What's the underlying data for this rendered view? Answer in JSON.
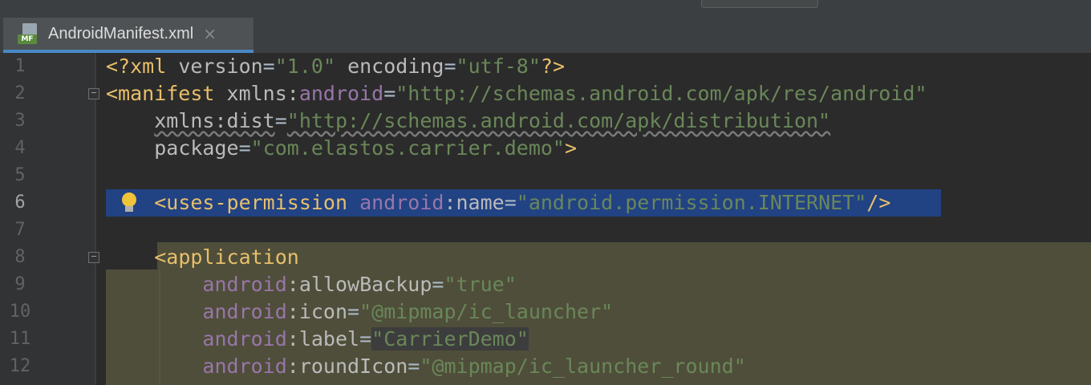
{
  "tab": {
    "file_label": "MF",
    "title": "AndroidManifest.xml",
    "close": "×"
  },
  "editor": {
    "line_numbers": [
      "1",
      "2",
      "3",
      "4",
      "5",
      "6",
      "7",
      "8",
      "9",
      "10",
      "11",
      "12"
    ],
    "lines": [
      [
        [
          "tag",
          "<?xml "
        ],
        [
          "attr",
          "version"
        ],
        [
          "str",
          "="
        ],
        [
          "val",
          "\"1.0\""
        ],
        [
          "str",
          " "
        ],
        [
          "attr",
          "encoding"
        ],
        [
          "str",
          "="
        ],
        [
          "val",
          "\"utf-8\""
        ],
        [
          "tag",
          "?>"
        ]
      ],
      [
        [
          "tag",
          "<manifest "
        ],
        [
          "attr",
          "xmlns:"
        ],
        [
          "ns",
          "android"
        ],
        [
          "str",
          "="
        ],
        [
          "val",
          "\"http://schemas.android.com/apk/res/android\""
        ]
      ],
      [
        [
          "str",
          "    "
        ],
        [
          "attr",
          "xmlns:dist"
        ],
        [
          "str",
          "="
        ],
        [
          "val",
          "\"http://schemas.android.com/apk/distribution\""
        ]
      ],
      [
        [
          "str",
          "    "
        ],
        [
          "attr",
          "package"
        ],
        [
          "str",
          "="
        ],
        [
          "val",
          "\"com.elastos.carrier.demo\""
        ],
        [
          "tag",
          ">"
        ]
      ],
      [],
      [
        [
          "str",
          "    "
        ],
        [
          "tag",
          "<uses-permission "
        ],
        [
          "ns",
          "android"
        ],
        [
          "attr",
          ":name"
        ],
        [
          "str",
          "="
        ],
        [
          "val",
          "\"android.permission.INTERNET\""
        ],
        [
          "tag",
          "/>"
        ]
      ],
      [],
      [
        [
          "str",
          "    "
        ],
        [
          "tag",
          "<application"
        ]
      ],
      [
        [
          "str",
          "        "
        ],
        [
          "ns",
          "android"
        ],
        [
          "attr",
          ":allowBackup"
        ],
        [
          "str",
          "="
        ],
        [
          "val",
          "\"true\""
        ]
      ],
      [
        [
          "str",
          "        "
        ],
        [
          "ns",
          "android"
        ],
        [
          "attr",
          ":icon"
        ],
        [
          "str",
          "="
        ],
        [
          "val",
          "\"@mipmap/ic_launcher\""
        ]
      ],
      [
        [
          "str",
          "        "
        ],
        [
          "ns",
          "android"
        ],
        [
          "attr",
          ":label"
        ],
        [
          "str",
          "="
        ],
        [
          "val",
          "\"CarrierDemo\""
        ]
      ],
      [
        [
          "str",
          "        "
        ],
        [
          "ns",
          "android"
        ],
        [
          "attr",
          ":roundIcon"
        ],
        [
          "str",
          "="
        ],
        [
          "val",
          "\"@mipmap/ic_launcher_round\""
        ]
      ]
    ]
  }
}
